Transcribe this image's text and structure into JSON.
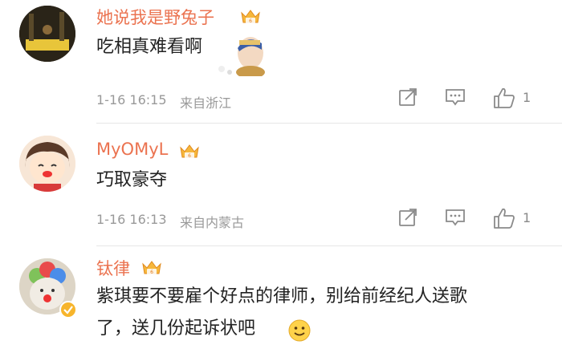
{
  "comments": [
    {
      "username": "她说我是野兔子",
      "text": "吃相真难看啊",
      "time": "1-16 16:15",
      "location": "来自浙江",
      "likes": ""
    },
    {
      "username": "MyOMyL",
      "text": "巧取豪夺",
      "time": "1-16 16:13",
      "location": "来自内蒙古",
      "likes": ""
    },
    {
      "username": "钛律",
      "text_line1": "紫琪要不要雇个好点的律师，别给前经纪人送歌",
      "text_line2": "了，送几份起诉状吧"
    }
  ],
  "colors": {
    "username": "#eb7350",
    "meta": "#999999",
    "icon": "#8a8a8a"
  },
  "icons": [
    "vip-crown-icon",
    "forward-icon",
    "comment-icon",
    "like-icon",
    "verified-badge-icon",
    "smile-emoji-icon"
  ]
}
